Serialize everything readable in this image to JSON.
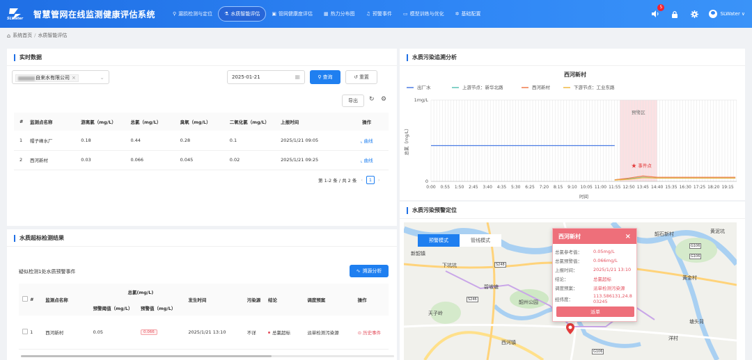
{
  "app": {
    "title": "智慧管网在线监测健康评估系统",
    "logo_text": "SLWater"
  },
  "nav": [
    {
      "label": "漏损检测与定位",
      "icon": "pipe-icon",
      "glyph": "⚲",
      "active": false
    },
    {
      "label": "水质智能评估",
      "icon": "flask-icon",
      "glyph": "⚗",
      "active": true
    },
    {
      "label": "管网健康度评估",
      "icon": "health-icon",
      "glyph": "▣",
      "active": false
    },
    {
      "label": "热力分布图",
      "icon": "heatmap-icon",
      "glyph": "▦",
      "active": false
    },
    {
      "label": "预警事件",
      "icon": "bell-icon",
      "glyph": "♫",
      "active": false
    },
    {
      "label": "模型训练与优化",
      "icon": "model-icon",
      "glyph": "▭",
      "active": false
    },
    {
      "label": "基础配置",
      "icon": "gear-icon",
      "glyph": "✲",
      "active": false
    }
  ],
  "header_right": {
    "notification_count": "5",
    "username": "SLWater"
  },
  "breadcrumb": {
    "home": "系统首页",
    "current": "水质智能评估"
  },
  "realtime": {
    "title": "实时数据",
    "company_tag": "自来水有限公司",
    "date": "2025-01-21",
    "query_label": "查询",
    "reset_label": "重置",
    "export_label": "导出",
    "columns": [
      "#",
      "监测点名称",
      "游离氯（mg/L）",
      "总氯（mg/L）",
      "臭氧（mg/L）",
      "二氧化氯（mg/L）",
      "上报时间",
      "操作"
    ],
    "rows": [
      {
        "idx": "1",
        "name": "帽子峰水厂",
        "free_cl": "0.18",
        "total_cl": "0.44",
        "ozone": "0.28",
        "clo2": "0.1",
        "time": "2025/1/21 09:05",
        "action": "曲线"
      },
      {
        "idx": "2",
        "name": "西河新村",
        "free_cl": "0.03",
        "total_cl": "0.066",
        "ozone": "0.045",
        "clo2": "0.02",
        "time": "2025/1/21 09:25",
        "action": "曲线"
      }
    ],
    "pager_text": "第 1-2 条 / 共 2 条",
    "page": "1"
  },
  "exceed": {
    "title": "水质超标检测结果",
    "summary": "疑似检测1处水质预警事件",
    "trace_label": "溯源分析",
    "group_header": "总氯(mg/L)",
    "columns": {
      "idx": "#",
      "name": "监测点名称",
      "threshold": "预警阈值（mg/L）",
      "warn_value": "预警值（mg/L）",
      "time": "发生时间",
      "source": "污染源",
      "conclusion": "结论",
      "plan": "调度预案",
      "action": "操作"
    },
    "rows": [
      {
        "idx": "1",
        "name": "西河新村",
        "threshold": "0.05",
        "warn_value": "0.066",
        "time": "2025/1/21 13:10",
        "source": "不详",
        "conclusion": "总氯超标",
        "plan": "派单检测污染源",
        "action": "历史事件"
      }
    ]
  },
  "trace": {
    "title": "水质污染追溯分析"
  },
  "chart_data": {
    "type": "line",
    "title": "西河新村",
    "xlabel": "时间",
    "ylabel": "总氯（mg/L）",
    "ylim": [
      0,
      1
    ],
    "y_ticks": [
      "0",
      "1mg/L"
    ],
    "x_ticks": [
      "0:00",
      "0:55",
      "1:50",
      "2:45",
      "3:40",
      "4:35",
      "5:30",
      "6:25",
      "7:20",
      "8:15",
      "9:10",
      "10:05",
      "11:00",
      "11:55",
      "12:50",
      "13:45",
      "14:40",
      "15:35",
      "16:30",
      "17:25",
      "18:20",
      "19:15"
    ],
    "warning_band_label": "预警区",
    "warning_band": [
      "12:15",
      "14:40"
    ],
    "event_label": "事件点",
    "event_point": {
      "x": "13:10",
      "y": 0.066
    },
    "series": [
      {
        "name": "出厂水",
        "color": "#4a7be3",
        "x": [
          "0:00",
          "11:55"
        ],
        "values": [
          0.44,
          0.44
        ]
      },
      {
        "name": "上游节点：新华北路",
        "color": "#5bc2b4",
        "x": [
          "11:55",
          "12:50",
          "13:45",
          "14:40",
          "15:35",
          "16:30",
          "17:25",
          "18:20",
          "19:15",
          "19:45"
        ],
        "values": [
          0.02,
          0.03,
          0.05,
          0.04,
          0.04,
          0.04,
          0.04,
          0.04,
          0.04,
          0.04
        ]
      },
      {
        "name": "西河新村",
        "color": "#f07a4a",
        "x": [
          "11:55",
          "12:50",
          "13:45",
          "14:40",
          "15:35",
          "16:30",
          "17:25",
          "18:20",
          "19:15",
          "19:45"
        ],
        "values": [
          0.02,
          0.04,
          0.066,
          0.05,
          0.05,
          0.05,
          0.05,
          0.05,
          0.05,
          0.05
        ]
      },
      {
        "name": "下游节点：工业东路",
        "color": "#f0b840",
        "x": [
          "11:55",
          "12:50",
          "13:45",
          "14:40",
          "15:35",
          "16:30",
          "17:25",
          "18:20",
          "19:15",
          "19:45"
        ],
        "values": [
          0.015,
          0.025,
          0.045,
          0.04,
          0.04,
          0.04,
          0.04,
          0.04,
          0.04,
          0.04
        ]
      }
    ]
  },
  "locate": {
    "title": "水质污染预警定位",
    "mode_warn": "预警模式",
    "mode_network": "管线模式",
    "popup": {
      "title": "西河新村",
      "rows": [
        {
          "k": "总氯参考值：",
          "v": "0.05mg/L"
        },
        {
          "k": "总氯预警值：",
          "v": "0.066mg/L"
        },
        {
          "k": "上报时间：",
          "v": "2025/1/21 13:10"
        },
        {
          "k": "结论：",
          "v": "总氯超标"
        },
        {
          "k": "调度预案：",
          "v": "派单检测污染源"
        },
        {
          "k": "经纬度：",
          "v": "113.586131,24.803245"
        }
      ],
      "button": "派单"
    },
    "places": [
      {
        "name": "新韶镇",
        "key": "xinshao"
      },
      {
        "name": "韶石新村",
        "key": "shaoshi"
      },
      {
        "name": "黄泥坑",
        "key": "huangni"
      },
      {
        "name": "下坑坑",
        "key": "xiakeng"
      },
      {
        "name": "碧坡塘",
        "key": "bipo"
      },
      {
        "name": "天子岭",
        "key": "tianzi"
      },
      {
        "name": "韶州公园",
        "key": "park"
      },
      {
        "name": "黄金村",
        "key": "huangjin"
      },
      {
        "name": "塘头背",
        "key": "tangtou"
      },
      {
        "name": "西河镇",
        "key": "xihe"
      },
      {
        "name": "洋村",
        "key": "yang"
      }
    ],
    "roads": [
      {
        "name": "S248",
        "key": "s248"
      },
      {
        "name": "S246",
        "key": "s246"
      },
      {
        "name": "G106",
        "key": "g106a"
      },
      {
        "name": "G106",
        "key": "g106b"
      },
      {
        "name": "G106",
        "key": "g106c"
      }
    ]
  }
}
